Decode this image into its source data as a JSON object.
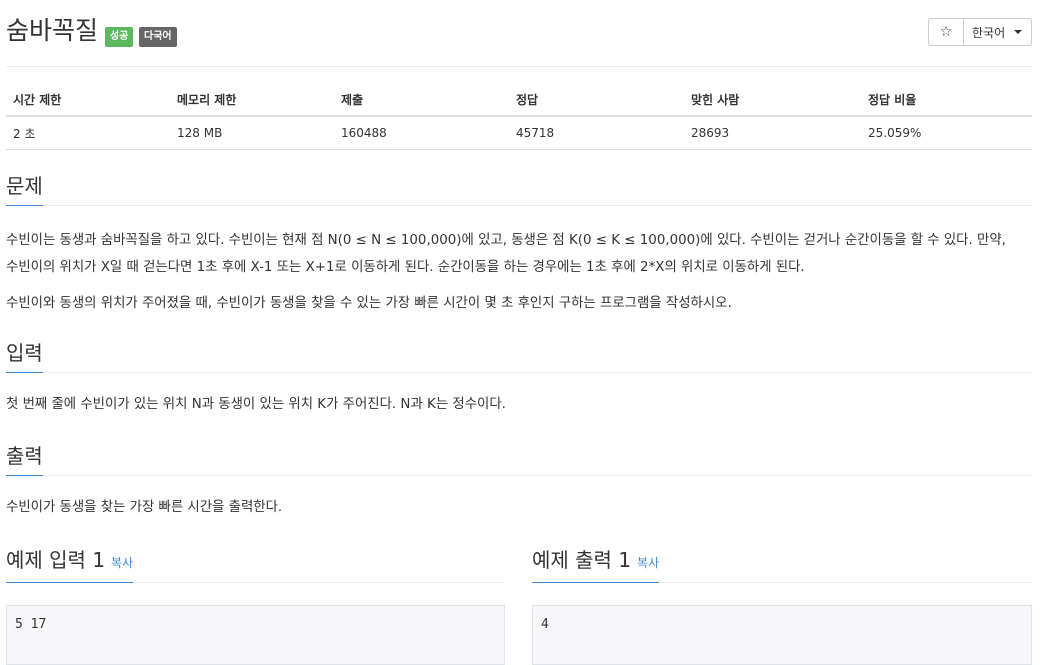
{
  "problem": {
    "title": "숨바꼭질",
    "badges": {
      "success": "성공",
      "multilang": "다국어"
    }
  },
  "toolbar": {
    "star_icon": "☆",
    "language": "한국어"
  },
  "info_table": {
    "headers": [
      "시간 제한",
      "메모리 제한",
      "제출",
      "정답",
      "맞힌 사람",
      "정답 비율"
    ],
    "values": [
      "2 초",
      "128 MB",
      "160488",
      "45718",
      "28693",
      "25.059%"
    ]
  },
  "sections": {
    "problem": {
      "title": "문제",
      "paragraphs": [
        "수빈이는 동생과 숨바꼭질을 하고 있다. 수빈이는 현재 점 N(0 ≤ N ≤ 100,000)에 있고, 동생은 점 K(0 ≤ K ≤ 100,000)에 있다. 수빈이는 걷거나 순간이동을 할 수 있다. 만약,",
        "수빈이의 위치가 X일 때 걷는다면 1초 후에 X-1 또는 X+1로 이동하게 된다. 순간이동을 하는 경우에는 1초 후에 2*X의 위치로 이동하게 된다.",
        "수빈이와 동생의 위치가 주어졌을 때, 수빈이가 동생을 찾을 수 있는 가장 빠른 시간이 몇 초 후인지 구하는 프로그램을 작성하시오."
      ]
    },
    "input": {
      "title": "입력",
      "text": "첫 번째 줄에 수빈이가 있는 위치 N과 동생이 있는 위치 K가 주어진다. N과 K는 정수이다."
    },
    "output": {
      "title": "출력",
      "text": "수빈이가 동생을 찾는 가장 빠른 시간을 출력한다."
    }
  },
  "samples": {
    "input": {
      "title": "예제 입력 1",
      "copy": "복사",
      "value": "5 17"
    },
    "output": {
      "title": "예제 출력 1",
      "copy": "복사",
      "value": "4"
    }
  }
}
